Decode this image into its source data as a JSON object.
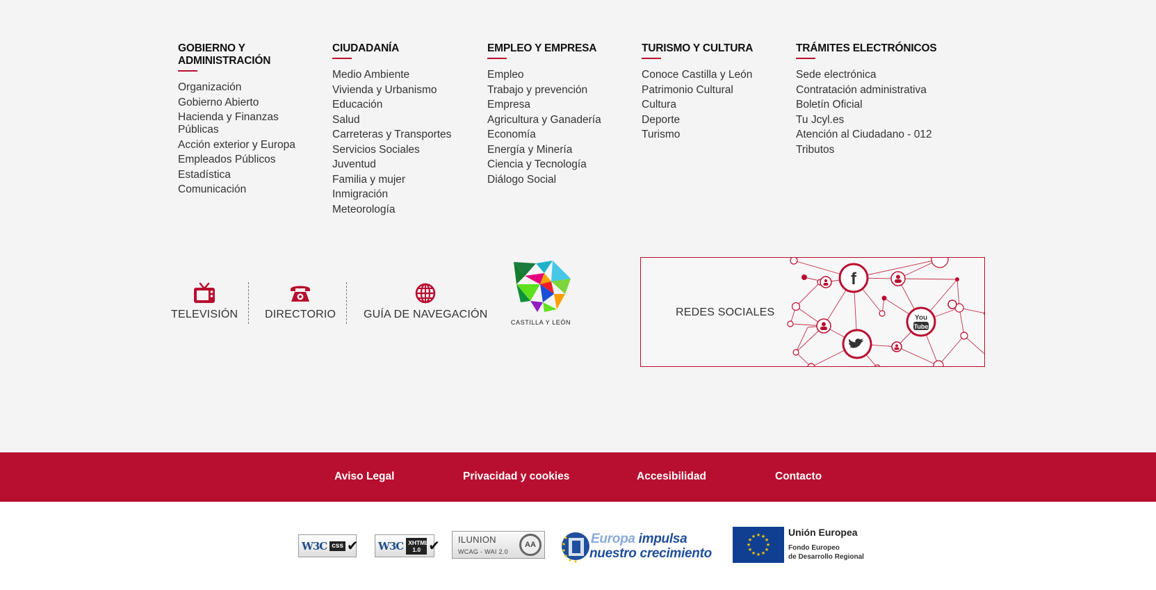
{
  "columns": [
    {
      "title": "GOBIERNO Y ADMINISTRACIÓN",
      "items": [
        "Organización",
        "Gobierno Abierto",
        "Hacienda y Finanzas Públicas",
        "Acción exterior y Europa",
        "Empleados Públicos",
        "Estadística",
        "Comunicación"
      ]
    },
    {
      "title": "CIUDADANÍA",
      "items": [
        "Medio Ambiente",
        "Vivienda y Urbanismo",
        "Educación",
        "Salud",
        "Carreteras y Transportes",
        "Servicios Sociales",
        "Juventud",
        "Familia y mujer",
        "Inmigración",
        "Meteorología"
      ]
    },
    {
      "title": "EMPLEO Y EMPRESA",
      "items": [
        "Empleo",
        "Trabajo y prevención",
        "Empresa",
        "Agricultura y Ganadería",
        "Economía",
        "Energía y Minería",
        "Ciencia y Tecnología",
        "Diálogo Social"
      ]
    },
    {
      "title": "TURISMO Y CULTURA",
      "items": [
        "Conoce Castilla y León",
        "Patrimonio Cultural",
        "Cultura",
        "Deporte",
        "Turismo"
      ]
    },
    {
      "title": "TRÁMITES ELECTRÓNICOS",
      "items": [
        "Sede electrónica",
        "Contratación administrativa",
        "Boletín Oficial",
        "Tu Jcyl.es",
        "Atención al Ciudadano - 012",
        "Tributos"
      ]
    }
  ],
  "quick_links": {
    "tv": "TELEVISIÓN",
    "directory": "DIRECTORIO",
    "guide": "GUÍA DE NAVEGACIÓN"
  },
  "logo_caption": "CASTILLA Y LEÓN",
  "social": {
    "label": "REDES SOCIALES",
    "networks": [
      "facebook-icon",
      "youtube-icon",
      "twitter-icon"
    ],
    "youtube_text": [
      "You",
      "Tube"
    ]
  },
  "bottom_links": [
    "Aviso Legal",
    "Privacidad y cookies",
    "Accesibilidad",
    "Contacto"
  ],
  "badges": {
    "w3c_css": {
      "mark": "W3C",
      "tag": "css"
    },
    "w3c_xhtml": {
      "mark": "W3C",
      "tag": "XHTML 1.0"
    },
    "ilunion": {
      "line1": "ILUNION",
      "line2": "WCAG - WAI  2.0",
      "level": "AA"
    },
    "europa": {
      "line1a": "Europa",
      "line1b": " impulsa",
      "line2": "nuestro crecimiento"
    },
    "ue": {
      "name": "Unión Europea",
      "fund_line1": "Fondo Europeo",
      "fund_line2": "de Desarrollo Regional"
    }
  },
  "colors": {
    "accent": "#b80e2f",
    "background": "#f4f4f4",
    "text": "#333333"
  }
}
